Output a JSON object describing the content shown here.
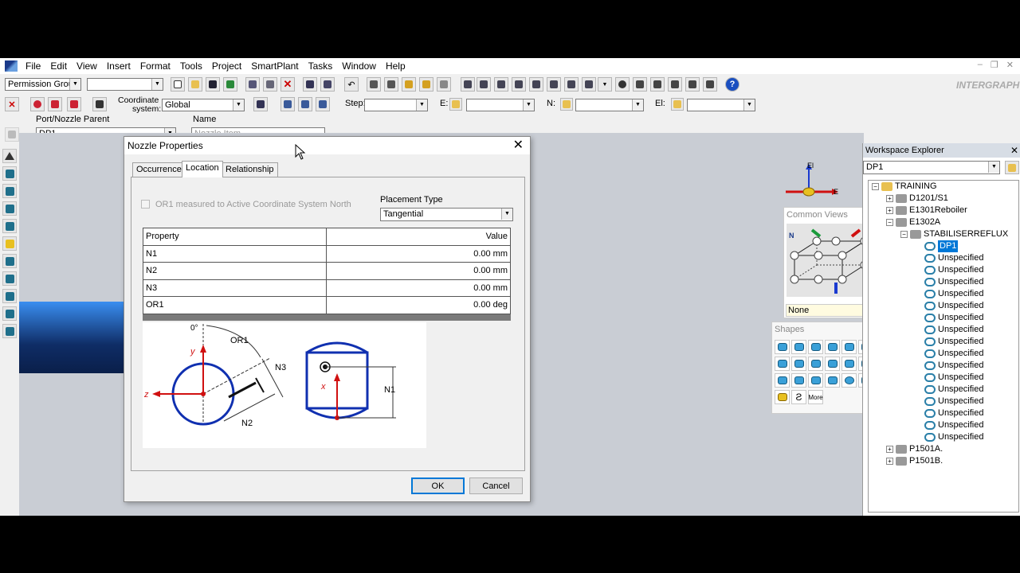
{
  "menu": [
    "File",
    "Edit",
    "View",
    "Insert",
    "Format",
    "Tools",
    "Project",
    "SmartPlant",
    "Tasks",
    "Window",
    "Help"
  ],
  "toolbar1": {
    "permission_group": "Permission Group",
    "brand": "INTERGRAPH"
  },
  "toolbar2": {
    "coord_label1": "Coordinate",
    "coord_label2": "system:",
    "coord_value": "Global",
    "step_label": "Step:",
    "e_label": "E:",
    "n_label": "N:",
    "el_label": "El:"
  },
  "toolbar3": {
    "port_parent_label": "Port/Nozzle Parent",
    "port_parent_value": "DP1",
    "name_label": "Name",
    "name_placeholder": "Nozzle Item"
  },
  "dialog": {
    "title": "Nozzle Properties",
    "tabs": [
      "Occurrence",
      "Location",
      "Relationship"
    ],
    "active_tab": "Location",
    "or1_checkbox_label": "OR1 measured to Active Coordinate System North",
    "placement_type_label": "Placement Type",
    "placement_type_value": "Tangential",
    "table": {
      "headers": [
        "Property",
        "Value"
      ],
      "rows": [
        {
          "property": "N1",
          "value": "0.00 mm"
        },
        {
          "property": "N2",
          "value": "0.00 mm"
        },
        {
          "property": "N3",
          "value": "0.00 mm"
        },
        {
          "property": "OR1",
          "value": "0.00 deg"
        }
      ]
    },
    "diagram_labels": {
      "zero": "0°",
      "or1": "OR1",
      "y": "y",
      "z": "z",
      "x": "x",
      "n1": "N1",
      "n2": "N2",
      "n3": "N3"
    },
    "ok_label": "OK",
    "cancel_label": "Cancel"
  },
  "compass": {
    "el": "El",
    "e": "E"
  },
  "common_views": {
    "title": "Common Views",
    "n": "N",
    "status": "None"
  },
  "shapes": {
    "title": "Shapes",
    "more": "More"
  },
  "workspace": {
    "title": "Workspace Explorer",
    "filter": "DP1",
    "tree": [
      {
        "label": "TRAINING",
        "level": 0,
        "pm": "−"
      },
      {
        "label": "D1201/S1",
        "level": 1,
        "pm": "+"
      },
      {
        "label": "E1301Reboiler",
        "level": 1,
        "pm": "+"
      },
      {
        "label": "E1302A",
        "level": 1,
        "pm": "−"
      },
      {
        "label": "STABILISERREFLUX",
        "level": 2,
        "pm": "−"
      },
      {
        "label": "DP1",
        "level": 3,
        "selected": true
      },
      {
        "label": "Unspecified",
        "level": 3
      },
      {
        "label": "Unspecified",
        "level": 3
      },
      {
        "label": "Unspecified",
        "level": 3
      },
      {
        "label": "Unspecified",
        "level": 3
      },
      {
        "label": "Unspecified",
        "level": 3
      },
      {
        "label": "Unspecified",
        "level": 3
      },
      {
        "label": "Unspecified",
        "level": 3
      },
      {
        "label": "Unspecified",
        "level": 3
      },
      {
        "label": "Unspecified",
        "level": 3
      },
      {
        "label": "Unspecified",
        "level": 3
      },
      {
        "label": "Unspecified",
        "level": 3
      },
      {
        "label": "Unspecified",
        "level": 3
      },
      {
        "label": "Unspecified",
        "level": 3
      },
      {
        "label": "Unspecified",
        "level": 3
      },
      {
        "label": "Unspecified",
        "level": 3
      },
      {
        "label": "Unspecified",
        "level": 3
      },
      {
        "label": "P1501A.",
        "level": 1,
        "pm": "+"
      },
      {
        "label": "P1501B.",
        "level": 1,
        "pm": "+"
      }
    ]
  }
}
